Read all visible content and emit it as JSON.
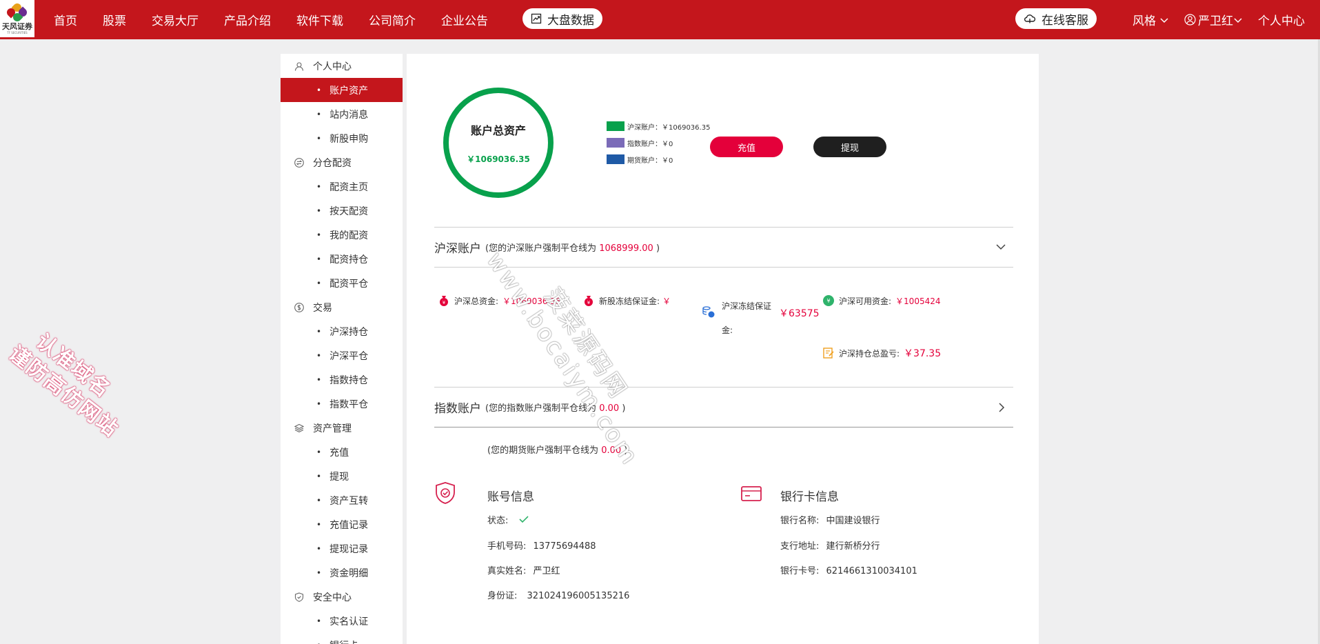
{
  "brand": {
    "logo_text": "天风证券",
    "logo_sub": "TF SECURITIES"
  },
  "nav": {
    "items": [
      "首页",
      "股票",
      "交易大厅",
      "产品介绍",
      "软件下载",
      "公司简介",
      "企业公告"
    ],
    "market_data": "大盘数据",
    "online_service": "在线客服",
    "style": "风格",
    "user": "严卫红",
    "user_center": "个人中心"
  },
  "sidebar": {
    "groups": [
      {
        "label": "个人中心",
        "icon": "user-icon",
        "items": [
          "账户资产",
          "站内消息",
          "新股申购"
        ]
      },
      {
        "label": "分仓配资",
        "icon": "swap-icon",
        "items": [
          "配资主页",
          "按天配资",
          "我的配资",
          "配资持仓",
          "配资平仓"
        ]
      },
      {
        "label": "交易",
        "icon": "coin-icon",
        "items": [
          "沪深持仓",
          "沪深平仓",
          "指数持仓",
          "指数平仓"
        ]
      },
      {
        "label": "资产管理",
        "icon": "layers-icon",
        "items": [
          "充值",
          "提现",
          "资产互转",
          "充值记录",
          "提现记录",
          "资金明细"
        ]
      },
      {
        "label": "安全中心",
        "icon": "shield-icon",
        "items": [
          "实名认证",
          "银行卡"
        ]
      }
    ],
    "active": "账户资产"
  },
  "assets": {
    "title": "账户总资产",
    "total": "￥1069036.35",
    "legend": [
      {
        "label": "沪深账户：￥1069036.35",
        "color": "#08a14c"
      },
      {
        "label": "指数账户：￥0",
        "color": "#7b6bb8"
      },
      {
        "label": "期货账户：￥0",
        "color": "#1f5aa6"
      }
    ],
    "recharge_label": "充值",
    "withdraw_label": "提现"
  },
  "hs_account": {
    "title": "沪深账户",
    "note_prefix": "(您的沪深账户强制平仓线为",
    "note_value": "1068999.00",
    "note_suffix": ")",
    "total_funds_label": "沪深总资金:",
    "total_funds_value": "￥1069036.35",
    "ipo_frozen_label": "新股冻结保证金:",
    "ipo_frozen_value": "￥",
    "frozen_deposit_label": "沪深冻结保证金:",
    "frozen_deposit_value": "￥63575",
    "available_label": "沪深可用资金:",
    "available_value": "￥1005424",
    "pnl_label": "沪深持仓总盈亏:",
    "pnl_value": "￥37.35"
  },
  "index_account": {
    "title": "指数账户",
    "note_prefix": "(您的指数账户强制平仓线为",
    "note_value": "0.00",
    "note_suffix": ")"
  },
  "futures_note": {
    "prefix": "(您的期货账户强制平仓线为",
    "value": "0.00",
    "suffix": ")"
  },
  "account_info": {
    "title": "账号信息",
    "status_label": "状态:",
    "phone_label": "手机号码:",
    "phone": "13775694488",
    "name_label": "真实姓名:",
    "name": "严卫红",
    "id_label": "身份证:",
    "id": "321024196005135216"
  },
  "bank_info": {
    "title": "银行卡信息",
    "bank_label": "银行名称:",
    "bank": "中国建设银行",
    "branch_label": "支行地址:",
    "branch": "建行新桥分行",
    "card_label": "银行卡号:",
    "card": "6214661310034101"
  },
  "watermarks": {
    "pink_line1": "认准域名",
    "pink_line2": "谨防高仿网站",
    "gray_line1": "菠菜源码网",
    "gray_line2": "www.bocaiym.com"
  },
  "colors": {
    "brand_red": "#c4161c",
    "accent_red": "#e4003a",
    "green": "#08a14c"
  }
}
